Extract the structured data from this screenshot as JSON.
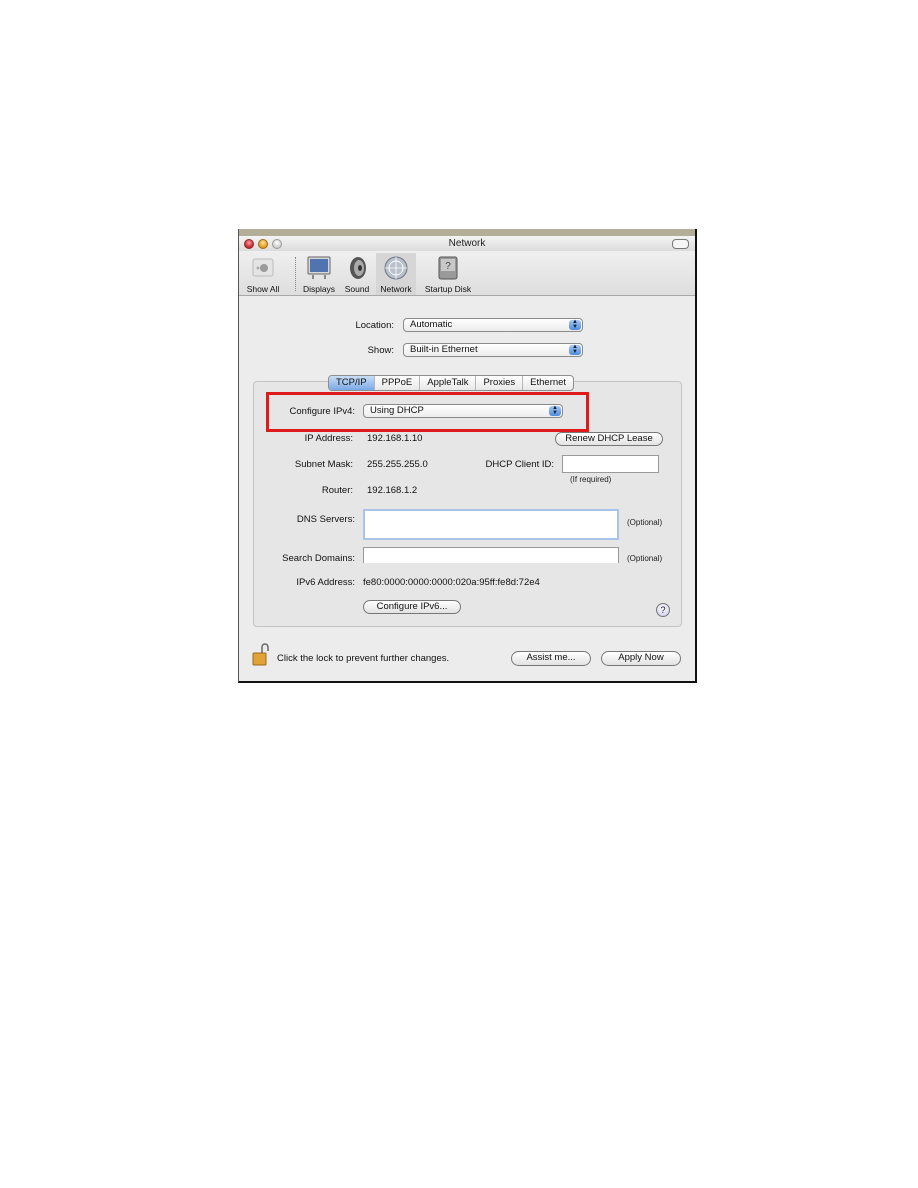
{
  "window": {
    "title": "Network"
  },
  "toolbar": {
    "items": [
      {
        "label": "Show All",
        "icon": "apple-show-all-icon"
      },
      {
        "label": "Displays",
        "icon": "display-icon"
      },
      {
        "label": "Sound",
        "icon": "speaker-icon"
      },
      {
        "label": "Network",
        "icon": "globe-icon",
        "selected": true
      },
      {
        "label": "Startup Disk",
        "icon": "hard-disk-icon"
      }
    ]
  },
  "location": {
    "label": "Location:",
    "value": "Automatic"
  },
  "show": {
    "label": "Show:",
    "value": "Built-in Ethernet"
  },
  "tabs": [
    {
      "label": "TCP/IP",
      "active": true
    },
    {
      "label": "PPPoE"
    },
    {
      "label": "AppleTalk"
    },
    {
      "label": "Proxies"
    },
    {
      "label": "Ethernet"
    }
  ],
  "tcpip": {
    "configure_ipv4_label": "Configure IPv4:",
    "configure_ipv4_value": "Using DHCP",
    "ip_address_label": "IP Address:",
    "ip_address": "192.168.1.10",
    "renew_button": "Renew DHCP Lease",
    "subnet_mask_label": "Subnet Mask:",
    "subnet_mask": "255.255.255.0",
    "dhcp_client_id_label": "DHCP Client ID:",
    "dhcp_client_id_value": "",
    "dhcp_client_id_hint": "(If required)",
    "router_label": "Router:",
    "router": "192.168.1.2",
    "dns_servers_label": "DNS Servers:",
    "dns_servers_value": "",
    "dns_optional": "(Optional)",
    "search_domains_label": "Search Domains:",
    "search_domains_value": "",
    "search_optional": "(Optional)",
    "ipv6_address_label": "IPv6 Address:",
    "ipv6_address": "fe80:0000:0000:0000:020a:95ff:fe8d:72e4",
    "configure_ipv6_button": "Configure IPv6...",
    "help_label": "?"
  },
  "footer": {
    "lock_text": "Click the lock to prevent further changes.",
    "assist_button": "Assist me...",
    "apply_button": "Apply Now"
  },
  "colors": {
    "highlight_box": "#e01a1a",
    "selected_tab": "#7aa9e6"
  }
}
